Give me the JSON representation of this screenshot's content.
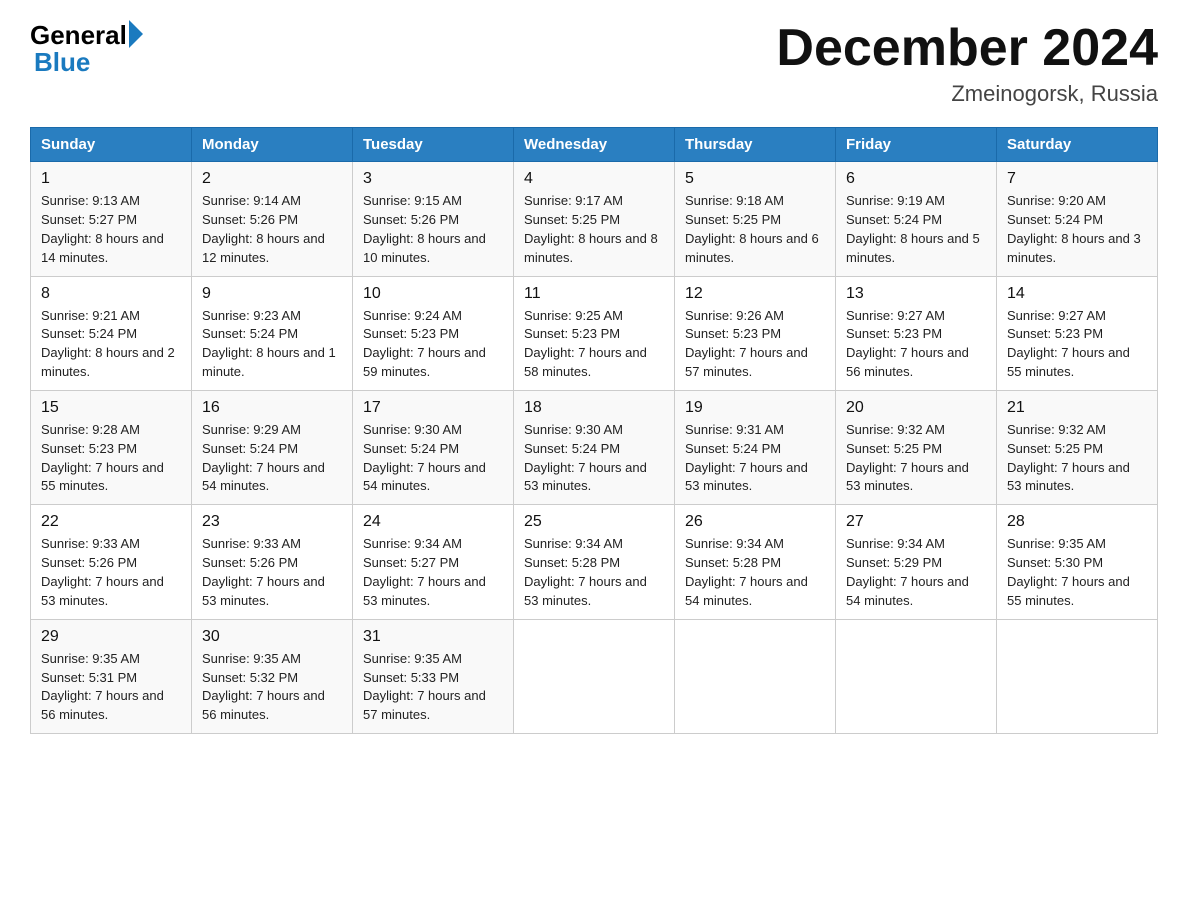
{
  "header": {
    "logo_general": "General",
    "logo_blue": "Blue",
    "month_year": "December 2024",
    "location": "Zmeinogorsk, Russia"
  },
  "days_of_week": [
    "Sunday",
    "Monday",
    "Tuesday",
    "Wednesday",
    "Thursday",
    "Friday",
    "Saturday"
  ],
  "weeks": [
    [
      {
        "day": "1",
        "sunrise": "9:13 AM",
        "sunset": "5:27 PM",
        "daylight": "8 hours and 14 minutes."
      },
      {
        "day": "2",
        "sunrise": "9:14 AM",
        "sunset": "5:26 PM",
        "daylight": "8 hours and 12 minutes."
      },
      {
        "day": "3",
        "sunrise": "9:15 AM",
        "sunset": "5:26 PM",
        "daylight": "8 hours and 10 minutes."
      },
      {
        "day": "4",
        "sunrise": "9:17 AM",
        "sunset": "5:25 PM",
        "daylight": "8 hours and 8 minutes."
      },
      {
        "day": "5",
        "sunrise": "9:18 AM",
        "sunset": "5:25 PM",
        "daylight": "8 hours and 6 minutes."
      },
      {
        "day": "6",
        "sunrise": "9:19 AM",
        "sunset": "5:24 PM",
        "daylight": "8 hours and 5 minutes."
      },
      {
        "day": "7",
        "sunrise": "9:20 AM",
        "sunset": "5:24 PM",
        "daylight": "8 hours and 3 minutes."
      }
    ],
    [
      {
        "day": "8",
        "sunrise": "9:21 AM",
        "sunset": "5:24 PM",
        "daylight": "8 hours and 2 minutes."
      },
      {
        "day": "9",
        "sunrise": "9:23 AM",
        "sunset": "5:24 PM",
        "daylight": "8 hours and 1 minute."
      },
      {
        "day": "10",
        "sunrise": "9:24 AM",
        "sunset": "5:23 PM",
        "daylight": "7 hours and 59 minutes."
      },
      {
        "day": "11",
        "sunrise": "9:25 AM",
        "sunset": "5:23 PM",
        "daylight": "7 hours and 58 minutes."
      },
      {
        "day": "12",
        "sunrise": "9:26 AM",
        "sunset": "5:23 PM",
        "daylight": "7 hours and 57 minutes."
      },
      {
        "day": "13",
        "sunrise": "9:27 AM",
        "sunset": "5:23 PM",
        "daylight": "7 hours and 56 minutes."
      },
      {
        "day": "14",
        "sunrise": "9:27 AM",
        "sunset": "5:23 PM",
        "daylight": "7 hours and 55 minutes."
      }
    ],
    [
      {
        "day": "15",
        "sunrise": "9:28 AM",
        "sunset": "5:23 PM",
        "daylight": "7 hours and 55 minutes."
      },
      {
        "day": "16",
        "sunrise": "9:29 AM",
        "sunset": "5:24 PM",
        "daylight": "7 hours and 54 minutes."
      },
      {
        "day": "17",
        "sunrise": "9:30 AM",
        "sunset": "5:24 PM",
        "daylight": "7 hours and 54 minutes."
      },
      {
        "day": "18",
        "sunrise": "9:30 AM",
        "sunset": "5:24 PM",
        "daylight": "7 hours and 53 minutes."
      },
      {
        "day": "19",
        "sunrise": "9:31 AM",
        "sunset": "5:24 PM",
        "daylight": "7 hours and 53 minutes."
      },
      {
        "day": "20",
        "sunrise": "9:32 AM",
        "sunset": "5:25 PM",
        "daylight": "7 hours and 53 minutes."
      },
      {
        "day": "21",
        "sunrise": "9:32 AM",
        "sunset": "5:25 PM",
        "daylight": "7 hours and 53 minutes."
      }
    ],
    [
      {
        "day": "22",
        "sunrise": "9:33 AM",
        "sunset": "5:26 PM",
        "daylight": "7 hours and 53 minutes."
      },
      {
        "day": "23",
        "sunrise": "9:33 AM",
        "sunset": "5:26 PM",
        "daylight": "7 hours and 53 minutes."
      },
      {
        "day": "24",
        "sunrise": "9:34 AM",
        "sunset": "5:27 PM",
        "daylight": "7 hours and 53 minutes."
      },
      {
        "day": "25",
        "sunrise": "9:34 AM",
        "sunset": "5:28 PM",
        "daylight": "7 hours and 53 minutes."
      },
      {
        "day": "26",
        "sunrise": "9:34 AM",
        "sunset": "5:28 PM",
        "daylight": "7 hours and 54 minutes."
      },
      {
        "day": "27",
        "sunrise": "9:34 AM",
        "sunset": "5:29 PM",
        "daylight": "7 hours and 54 minutes."
      },
      {
        "day": "28",
        "sunrise": "9:35 AM",
        "sunset": "5:30 PM",
        "daylight": "7 hours and 55 minutes."
      }
    ],
    [
      {
        "day": "29",
        "sunrise": "9:35 AM",
        "sunset": "5:31 PM",
        "daylight": "7 hours and 56 minutes."
      },
      {
        "day": "30",
        "sunrise": "9:35 AM",
        "sunset": "5:32 PM",
        "daylight": "7 hours and 56 minutes."
      },
      {
        "day": "31",
        "sunrise": "9:35 AM",
        "sunset": "5:33 PM",
        "daylight": "7 hours and 57 minutes."
      },
      null,
      null,
      null,
      null
    ]
  ]
}
